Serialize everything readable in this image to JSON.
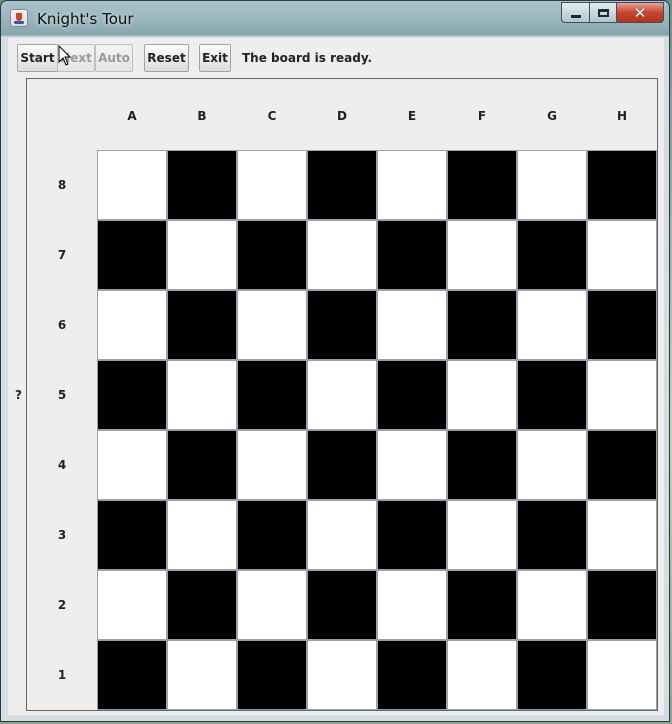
{
  "window": {
    "title": "Knight's Tour"
  },
  "toolbar": {
    "buttons": [
      {
        "label": "Start",
        "enabled": true
      },
      {
        "label": "Next",
        "enabled": false
      },
      {
        "label": "Auto",
        "enabled": false
      },
      {
        "label": "Reset",
        "enabled": true
      },
      {
        "label": "Exit",
        "enabled": true
      }
    ],
    "status": "The board is ready."
  },
  "side_label": "?",
  "board": {
    "files": [
      "A",
      "B",
      "C",
      "D",
      "E",
      "F",
      "G",
      "H"
    ],
    "ranks": [
      "8",
      "7",
      "6",
      "5",
      "4",
      "3",
      "2",
      "1"
    ],
    "light_color": "#ffffff",
    "dark_color": "#000000"
  },
  "icons": {
    "app": "java-cup-icon",
    "minimize": "minimize-icon",
    "maximize": "maximize-icon",
    "close": "close-icon",
    "cursor": "mouse-pointer-icon"
  }
}
